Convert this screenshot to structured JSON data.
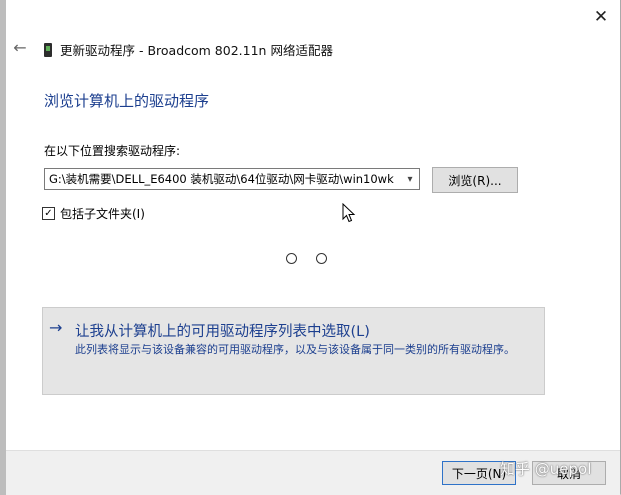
{
  "window": {
    "title": "更新驱动程序 - Broadcom 802.11n 网络适配器"
  },
  "icons": {
    "close": "close-icon",
    "back": "back-arrow-icon",
    "device": "network-adapter-icon",
    "cursor": "mouse-pointer-icon"
  },
  "heading": "浏览计算机上的驱动程序",
  "search": {
    "label": "在以下位置搜索驱动程序:",
    "path_value": "G:\\装机需要\\DELL_E6400 装机驱动\\64位驱动\\网卡驱动\\win10wk",
    "browse_label": "浏览(R)..."
  },
  "include_subfolders": {
    "label": "包括子文件夹(I)",
    "checked": true,
    "mark": "☑"
  },
  "option": {
    "arrow": "→",
    "title": "让我从计算机上的可用驱动程序列表中选取(L)",
    "description": "此列表将显示与该设备兼容的可用驱动程序，以及与该设备属于同一类别的所有驱动程序。"
  },
  "buttons": {
    "next": "下一页(N)",
    "cancel": "取消"
  },
  "watermark": "知乎 @uepol",
  "colors": {
    "accent": "#1c3f8f",
    "option_bg": "#e5e5e5",
    "button_bg": "#e1e1e1",
    "default_border": "#2e72c8"
  }
}
